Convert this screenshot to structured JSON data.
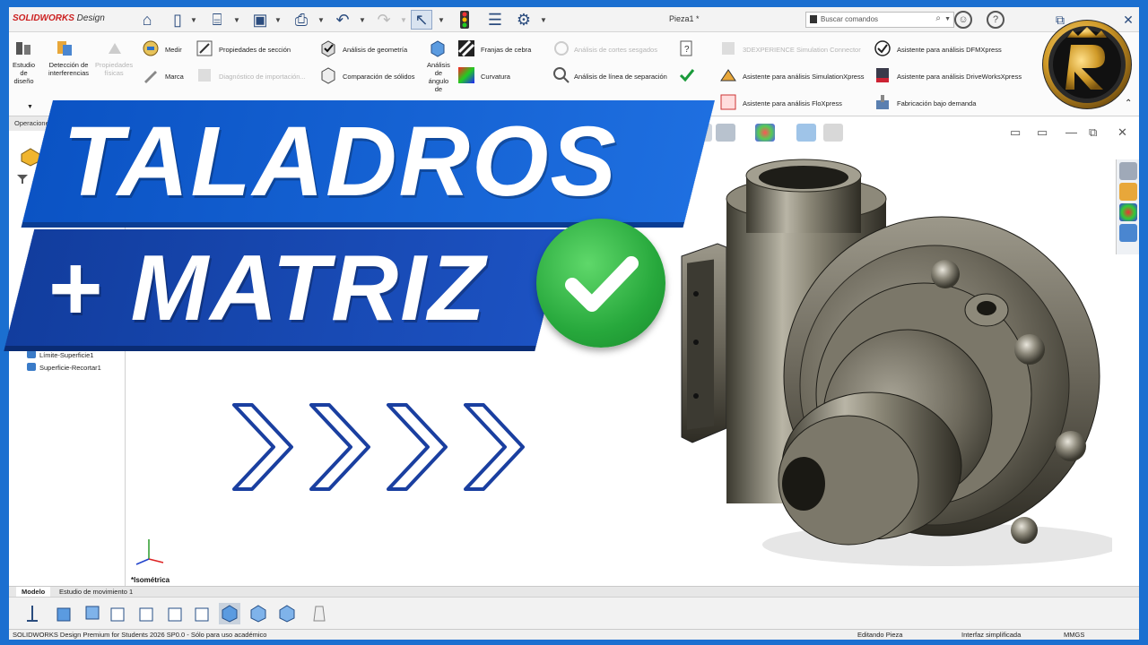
{
  "app": {
    "logo_brand": "SOLIDWORKS",
    "logo_rest": " Design",
    "document_title": "Pieza1 *",
    "search_placeholder": "Buscar comandos"
  },
  "ribbon": {
    "estudio": "Estudio\nde\ndiseño",
    "deteccion": "Detección de\ninterferencias",
    "propiedades": "Propiedades\nfísicas",
    "medir": "Medir",
    "marca": "Marca",
    "propiedades_seccion": "Propiedades de sección",
    "diagnostico": "Diagnóstico de importación...",
    "analisis_geometria": "Análisis de geometría",
    "comparacion": "Comparación de sólidos",
    "analisis_angulo": "Análisis\nde\nángulo\nde",
    "franjas": "Franjas de cebra",
    "curvatura": "Curvatura",
    "cortes_sesgados": "Análisis de cortes sesgados",
    "linea_separacion": "Análisis de línea de separación",
    "simulation_connector": "3DEXPERIENCE Simulation Connector",
    "simulationxpress": "Asistente para análisis SimulationXpress",
    "floxpress": "Asistente para análisis FloXpress",
    "dfmxpress": "Asistente para análisis DFMXpress",
    "driveworks": "Asistente para análisis DriveWorksXpress",
    "fabricacion": "Fabricación bajo demanda"
  },
  "ops_tab": "Operaciones",
  "tree": {
    "items": [
      "Límite-Superficie1",
      "Superficie-Recortar1"
    ]
  },
  "viewport": {
    "view_name": "*Isométrica"
  },
  "bottom_tabs": [
    "Modelo",
    "Estudio de movimiento 1"
  ],
  "status": {
    "product": "SOLIDWORKS Design Premium for Students 2026 SP0.0 - Sólo para uso académico",
    "editing": "Editando Pieza",
    "interface": "Interfaz simplificada",
    "units": "MMGS"
  },
  "headline": {
    "line1": "TALADROS",
    "line2": "+ MATRIZ"
  },
  "colors": {
    "frame_blue": "#1b6fd0",
    "banner_blue": "#1e6fe0",
    "check_green": "#27a83c",
    "arrow_navy": "#1a3fa0"
  }
}
